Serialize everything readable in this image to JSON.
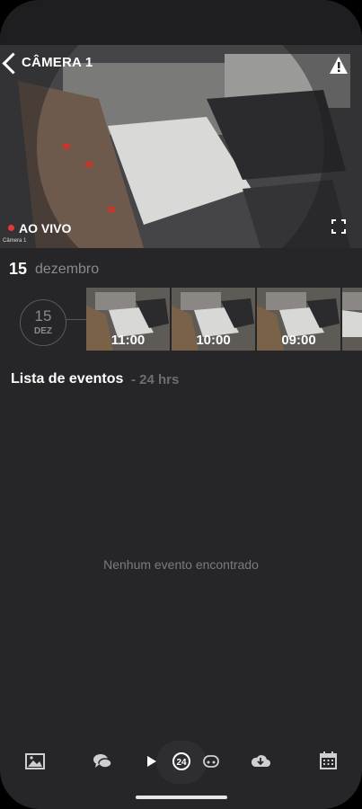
{
  "header": {
    "camera_title": "CÂMERA 1"
  },
  "video": {
    "live_label": "AO VIVO",
    "camera_caption": "Câmera 1"
  },
  "date_header": {
    "day": "15",
    "month": "dezembro"
  },
  "date_badge": {
    "day": "15",
    "month": "DEZ"
  },
  "thumbnails": [
    {
      "time": "11:00"
    },
    {
      "time": "10:00"
    },
    {
      "time": "09:00"
    }
  ],
  "events": {
    "title": "Lista de eventos",
    "range": "- 24 hrs",
    "empty_message": "Nenhum evento encontrado"
  },
  "bottom_nav": {
    "center_badge": "24",
    "icons": [
      "image-icon",
      "chat-icon",
      "play-icon",
      "history-24-icon",
      "cloud-icon",
      "cloud-download-icon",
      "calendar-icon"
    ]
  },
  "colors": {
    "background": "#262629",
    "accent_live": "#e53935",
    "muted_text": "#8a8a8e"
  }
}
